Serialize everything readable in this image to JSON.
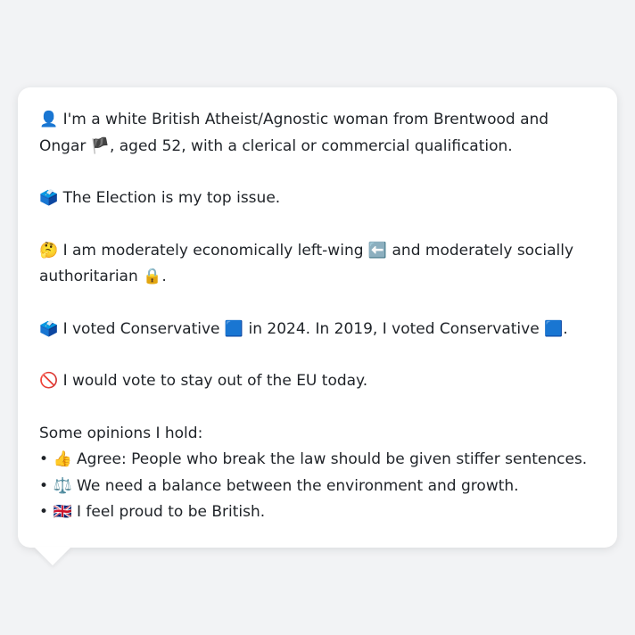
{
  "profile": {
    "person_emoji": "👤",
    "intro_line": " I'm a white British Atheist/Agnostic woman from Brentwood and Ongar ",
    "flag_emoji": "🏴",
    "intro_line_2": ", aged 52, with a clerical or commercial qualification.",
    "issue_emoji": "🗳️",
    "issue_text": " The Election is my top issue.",
    "thinking_emoji": "🤔",
    "economic_text": " I am moderately economically left-wing ",
    "left_arrow_emoji": "⬅️",
    "social_text": " and moderately socially authoritarian ",
    "lock_emoji": "🔒",
    "period": ".",
    "vote_emoji": "🗳️",
    "voted_text_1": " I voted Conservative ",
    "blue_square_1": "🟦",
    "voted_text_2": " in 2024. In 2019, I voted Conservative ",
    "blue_square_2": "🟦",
    "voted_end": ".",
    "no_entry_emoji": "🚫",
    "eu_text": " I would vote to stay out of the EU today."
  },
  "opinions": {
    "heading": "Some opinions I hold:",
    "items": [
      {
        "bullet": "•",
        "emoji": "👍",
        "text": " Agree: People who break the law should be given stiffer sentences."
      },
      {
        "bullet": "•",
        "emoji": "⚖️",
        "text": " We need a balance between the environment and growth."
      },
      {
        "bullet": "•",
        "emoji": "🇬🇧",
        "text": " I feel proud to be British."
      }
    ]
  }
}
